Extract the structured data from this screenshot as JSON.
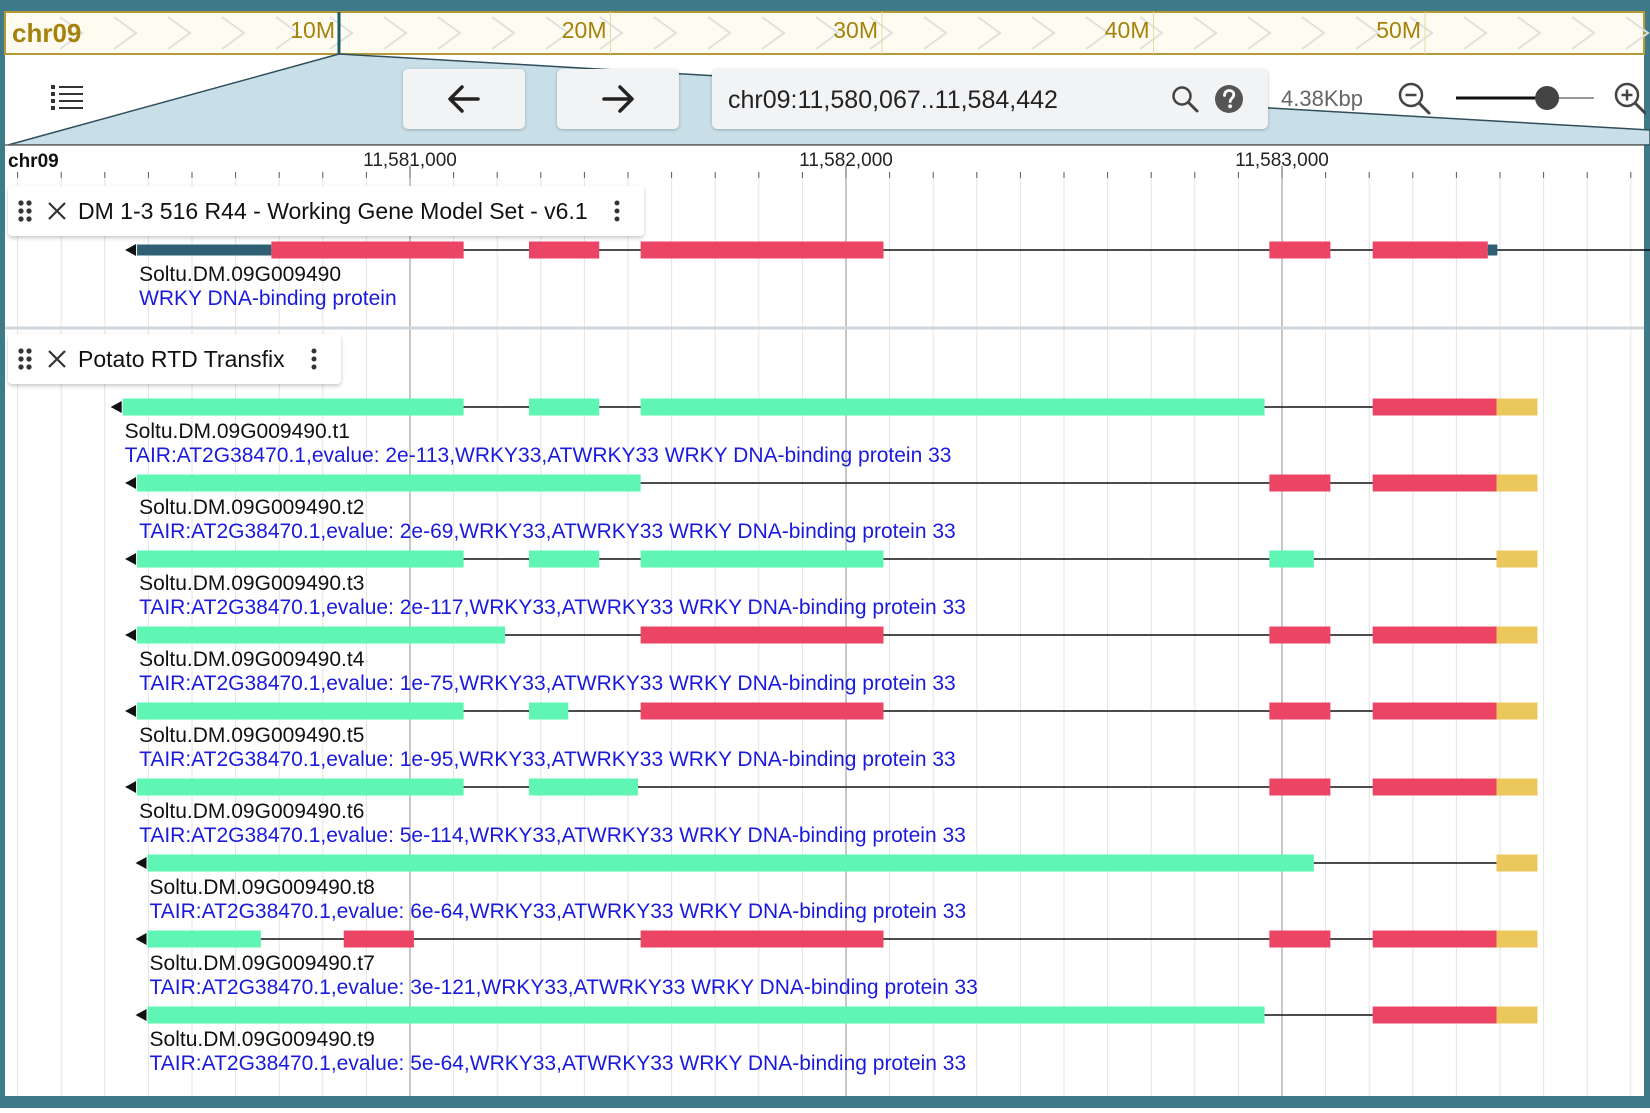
{
  "overview": {
    "chrom": "chr09",
    "ticks": [
      {
        "label": "10M",
        "pos": 10
      },
      {
        "label": "20M",
        "pos": 20
      },
      {
        "label": "30M",
        "pos": 30
      },
      {
        "label": "40M",
        "pos": 40
      },
      {
        "label": "50M",
        "pos": 50
      }
    ]
  },
  "toolbar": {
    "menu_icon": "list-icon",
    "back_icon": "arrow-left-icon",
    "forward_icon": "arrow-right-icon",
    "locus": "chr09:11,580,067..11,584,442",
    "search_icon": "search-icon",
    "help_icon": "help-icon",
    "span": "4.38Kbp",
    "zoom_out_icon": "zoom-out-icon",
    "zoom_in_icon": "zoom-in-icon",
    "zoom_level": 0.66
  },
  "ruler": {
    "chrom": "chr09",
    "major_ticks": [
      {
        "label": "11,581,000",
        "bp": 11581000
      },
      {
        "label": "11,582,000",
        "bp": 11582000
      },
      {
        "label": "11,583,000",
        "bp": 11583000
      }
    ]
  },
  "view": {
    "start": 11580067,
    "end": 11584442
  },
  "colors": {
    "cds": "#ec4465",
    "utr5": "#2e5f75",
    "exon_nc": "#5ef5b5",
    "utr3": "#ecc85c",
    "line": "#111111",
    "desc": "#1a1adc",
    "overview": "#a6810c"
  },
  "tracks": [
    {
      "title": "DM 1-3 516 R44 - Working Gene Model Set - v6.1",
      "drag_icon": "drag-handle-icon",
      "close_icon": "close-icon",
      "menu_icon": "kebab-menu-icon",
      "features": [
        {
          "name": "Soltu.DM.09G009490",
          "desc": "WRKY DNA-binding protein",
          "start": 11580374,
          "end": 11583943,
          "blocks": [
            {
              "s": 11580374,
              "e": 11580682,
              "t": "utr5"
            },
            {
              "s": 11580682,
              "e": 11581123,
              "t": "cds"
            },
            {
              "s": 11581273,
              "e": 11581434,
              "t": "cds"
            },
            {
              "s": 11581529,
              "e": 11582086,
              "t": "cds"
            },
            {
              "s": 11582971,
              "e": 11583111,
              "t": "cds"
            },
            {
              "s": 11583208,
              "e": 11583472,
              "t": "cds"
            },
            {
              "s": 11583472,
              "e": 11583494,
              "t": "utr5"
            }
          ]
        }
      ]
    },
    {
      "title": "Potato RTD Transfix",
      "drag_icon": "drag-handle-icon",
      "close_icon": "close-icon",
      "menu_icon": "kebab-menu-icon",
      "features": [
        {
          "name": "Soltu.DM.09G009490.t1",
          "desc": "TAIR:AT2G38470.1,evalue: 2e-113,WRKY33,ATWRKY33 WRKY DNA-binding protein 33",
          "start": 11580341,
          "end": 11583586,
          "blocks": [
            {
              "s": 11580341,
              "e": 11581123,
              "t": "exon_nc"
            },
            {
              "s": 11581273,
              "e": 11581434,
              "t": "exon_nc"
            },
            {
              "s": 11581529,
              "e": 11582960,
              "t": "exon_nc"
            },
            {
              "s": 11583208,
              "e": 11583492,
              "t": "cds"
            },
            {
              "s": 11583492,
              "e": 11583586,
              "t": "utr3"
            }
          ]
        },
        {
          "name": "Soltu.DM.09G009490.t2",
          "desc": "TAIR:AT2G38470.1,evalue: 2e-69,WRKY33,ATWRKY33 WRKY DNA-binding protein 33",
          "start": 11580374,
          "end": 11583586,
          "blocks": [
            {
              "s": 11580374,
              "e": 11581529,
              "t": "exon_nc"
            },
            {
              "s": 11582971,
              "e": 11583111,
              "t": "cds"
            },
            {
              "s": 11583208,
              "e": 11583492,
              "t": "cds"
            },
            {
              "s": 11583492,
              "e": 11583586,
              "t": "utr3"
            }
          ]
        },
        {
          "name": "Soltu.DM.09G009490.t3",
          "desc": "TAIR:AT2G38470.1,evalue: 2e-117,WRKY33,ATWRKY33 WRKY DNA-binding protein 33",
          "start": 11580374,
          "end": 11583586,
          "blocks": [
            {
              "s": 11580374,
              "e": 11581123,
              "t": "exon_nc"
            },
            {
              "s": 11581273,
              "e": 11581434,
              "t": "exon_nc"
            },
            {
              "s": 11581529,
              "e": 11582086,
              "t": "exon_nc"
            },
            {
              "s": 11582971,
              "e": 11583073,
              "t": "exon_nc"
            },
            {
              "s": 11583492,
              "e": 11583586,
              "t": "utr3"
            }
          ]
        },
        {
          "name": "Soltu.DM.09G009490.t4",
          "desc": "TAIR:AT2G38470.1,evalue: 1e-75,WRKY33,ATWRKY33 WRKY DNA-binding protein 33",
          "start": 11580374,
          "end": 11583586,
          "blocks": [
            {
              "s": 11580374,
              "e": 11581218,
              "t": "exon_nc"
            },
            {
              "s": 11581529,
              "e": 11582086,
              "t": "cds"
            },
            {
              "s": 11582971,
              "e": 11583111,
              "t": "cds"
            },
            {
              "s": 11583208,
              "e": 11583492,
              "t": "cds"
            },
            {
              "s": 11583492,
              "e": 11583586,
              "t": "utr3"
            }
          ]
        },
        {
          "name": "Soltu.DM.09G009490.t5",
          "desc": "TAIR:AT2G38470.1,evalue: 1e-95,WRKY33,ATWRKY33 WRKY DNA-binding protein 33",
          "start": 11580374,
          "end": 11583586,
          "blocks": [
            {
              "s": 11580374,
              "e": 11581123,
              "t": "exon_nc"
            },
            {
              "s": 11581273,
              "e": 11581363,
              "t": "exon_nc"
            },
            {
              "s": 11581529,
              "e": 11582086,
              "t": "cds"
            },
            {
              "s": 11582971,
              "e": 11583111,
              "t": "cds"
            },
            {
              "s": 11583208,
              "e": 11583492,
              "t": "cds"
            },
            {
              "s": 11583492,
              "e": 11583586,
              "t": "utr3"
            }
          ]
        },
        {
          "name": "Soltu.DM.09G009490.t6",
          "desc": "TAIR:AT2G38470.1,evalue: 5e-114,WRKY33,ATWRKY33 WRKY DNA-binding protein 33",
          "start": 11580374,
          "end": 11583586,
          "blocks": [
            {
              "s": 11580374,
              "e": 11581123,
              "t": "exon_nc"
            },
            {
              "s": 11581273,
              "e": 11581523,
              "t": "exon_nc"
            },
            {
              "s": 11582971,
              "e": 11583111,
              "t": "cds"
            },
            {
              "s": 11583208,
              "e": 11583492,
              "t": "cds"
            },
            {
              "s": 11583492,
              "e": 11583586,
              "t": "utr3"
            }
          ]
        },
        {
          "name": "Soltu.DM.09G009490.t8",
          "desc": "TAIR:AT2G38470.1,evalue: 6e-64,WRKY33,ATWRKY33 WRKY DNA-binding protein 33",
          "start": 11580398,
          "end": 11583586,
          "blocks": [
            {
              "s": 11580398,
              "e": 11583073,
              "t": "exon_nc"
            },
            {
              "s": 11583492,
              "e": 11583586,
              "t": "utr3"
            }
          ]
        },
        {
          "name": "Soltu.DM.09G009490.t7",
          "desc": "TAIR:AT2G38470.1,evalue: 3e-121,WRKY33,ATWRKY33 WRKY DNA-binding protein 33",
          "start": 11580398,
          "end": 11583586,
          "blocks": [
            {
              "s": 11580398,
              "e": 11580658,
              "t": "exon_nc"
            },
            {
              "s": 11580848,
              "e": 11581009,
              "t": "cds"
            },
            {
              "s": 11581529,
              "e": 11582086,
              "t": "cds"
            },
            {
              "s": 11582971,
              "e": 11583111,
              "t": "cds"
            },
            {
              "s": 11583208,
              "e": 11583492,
              "t": "cds"
            },
            {
              "s": 11583492,
              "e": 11583586,
              "t": "utr3"
            }
          ]
        },
        {
          "name": "Soltu.DM.09G009490.t9",
          "desc": "TAIR:AT2G38470.1,evalue: 5e-64,WRKY33,ATWRKY33 WRKY DNA-binding protein 33",
          "start": 11580398,
          "end": 11583586,
          "blocks": [
            {
              "s": 11580398,
              "e": 11582960,
              "t": "exon_nc"
            },
            {
              "s": 11583208,
              "e": 11583492,
              "t": "cds"
            },
            {
              "s": 11583492,
              "e": 11583586,
              "t": "utr3"
            }
          ]
        }
      ]
    }
  ]
}
